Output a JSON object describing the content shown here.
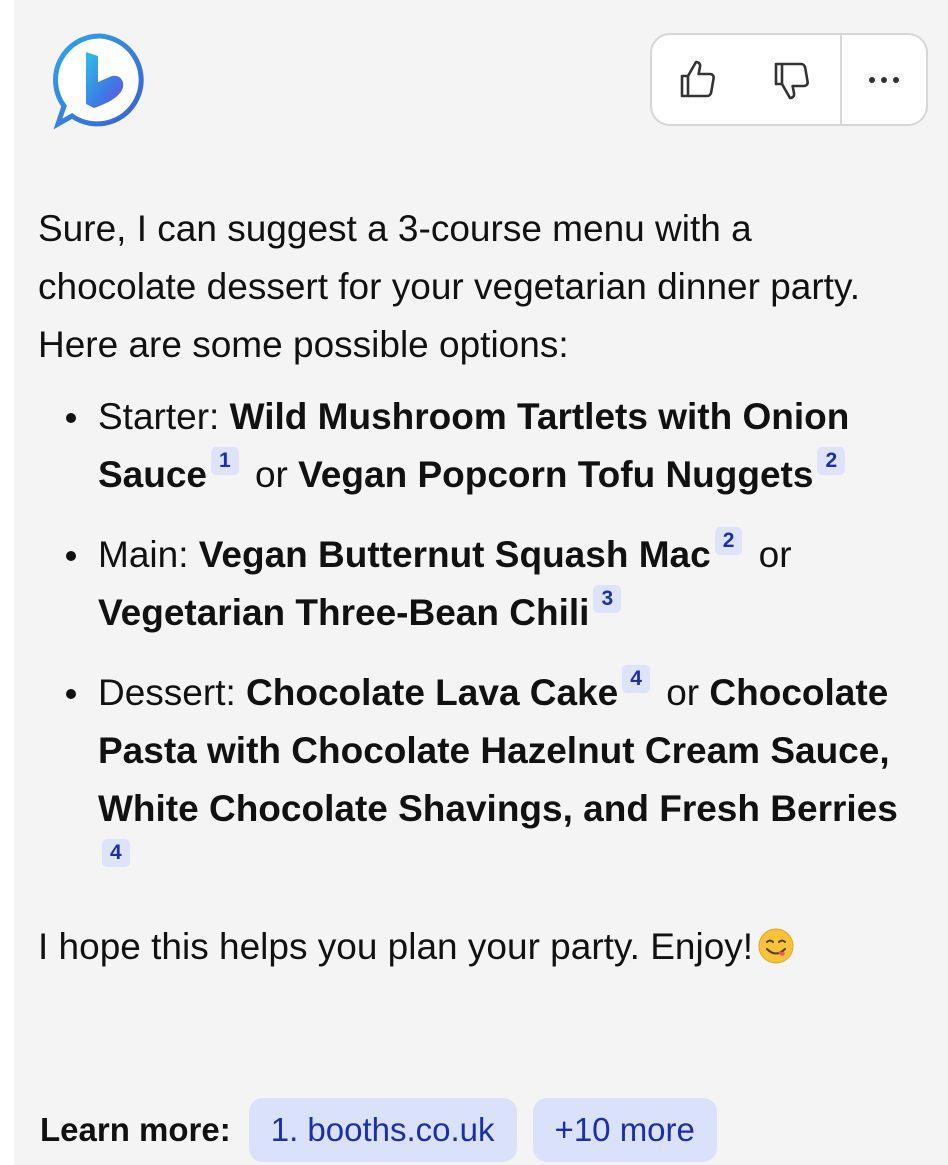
{
  "toolbar": {
    "like_icon": "thumbs-up-icon",
    "dislike_icon": "thumbs-down-icon",
    "more_icon": "more-options-icon"
  },
  "message": {
    "intro": "Sure, I can suggest a 3-course menu with a chocolate dessert for your vegetarian dinner party. Here are some possible options:",
    "items": [
      {
        "label": "Starter:",
        "option1": "Wild Mushroom Tartlets with Onion Sauce",
        "cite1": "1",
        "connector": "or",
        "option2": "Vegan Popcorn Tofu Nuggets",
        "cite2": "2"
      },
      {
        "label": "Main:",
        "option1": "Vegan Butternut Squash Mac",
        "cite1": "2",
        "connector": "or",
        "option2": "Vegetarian Three-Bean Chili",
        "cite2": "3"
      },
      {
        "label": "Dessert:",
        "option1": "Chocolate Lava Cake",
        "cite1": "4",
        "connector": "or",
        "option2": "Chocolate Pasta with Chocolate Hazelnut Cream Sauce, White Chocolate Shavings, and Fresh Berries",
        "cite2": "4"
      }
    ],
    "outro": "I hope this helps you plan your party. Enjoy!",
    "outro_emoji": "yum-face-emoji"
  },
  "learn_more": {
    "label": "Learn more:",
    "sources": [
      "1. booths.co.uk",
      "+10 more"
    ]
  },
  "colors": {
    "background": "#f4f4f4",
    "citation_bg": "#dde3fb",
    "citation_text": "#1a2fa8"
  }
}
